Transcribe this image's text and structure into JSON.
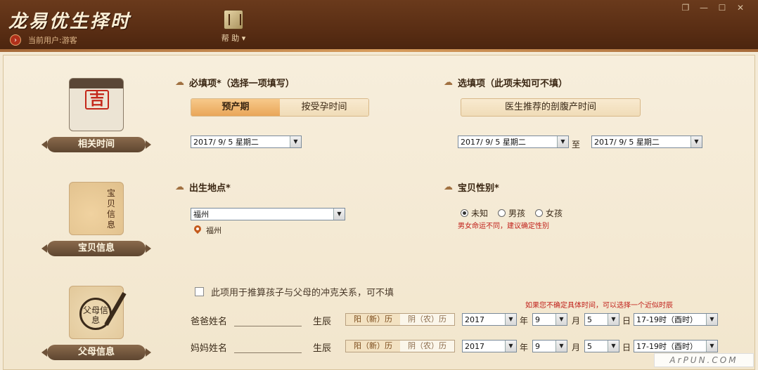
{
  "app": {
    "title": "龙易优生择时",
    "user_label": "当前用户:游客"
  },
  "menu": {
    "help": "帮 助 ▾"
  },
  "window_controls": [
    "❐",
    "—",
    "☐",
    "✕"
  ],
  "sidebar": [
    {
      "label": "相关时间",
      "image_text": "吉"
    },
    {
      "label": "宝贝信息",
      "image_text": "宝贝信息"
    },
    {
      "label": "父母信息",
      "image_text": "父母信息"
    }
  ],
  "required": {
    "title": "必填项*（选择一项填写）",
    "tabs": [
      {
        "label": "预产期",
        "active": true
      },
      {
        "label": "按受孕时间",
        "active": false
      }
    ],
    "date": "2017/ 9/ 5 星期二"
  },
  "optional": {
    "title": "选填项（此项未知可不填）",
    "tab": "医生推荐的剖腹产时间",
    "date_from": "2017/ 9/ 5 星期二",
    "to_label": "至",
    "date_to": "2017/ 9/ 5 星期二"
  },
  "birthplace": {
    "title": "出生地点*",
    "value": "福州",
    "location": "福州"
  },
  "gender": {
    "title": "宝贝性别*",
    "options": [
      {
        "label": "未知",
        "selected": true
      },
      {
        "label": "男孩",
        "selected": false
      },
      {
        "label": "女孩",
        "selected": false
      }
    ],
    "warning": "男女命运不同，建议确定性别"
  },
  "parents": {
    "checkbox_label": "此项用于推算孩子与父母的冲克关系，可不填",
    "hint": "如果您不确定具体时间，可以选择一个近似时辰",
    "birth_label": "生辰",
    "solar": "阳（新）历",
    "lunar": "阴（农）历",
    "rows": [
      {
        "name_label": "爸爸姓名",
        "year": "2017",
        "month": "9",
        "day": "5",
        "hour": "17-19时（酉时）"
      },
      {
        "name_label": "妈妈姓名",
        "year": "2017",
        "month": "9",
        "day": "5",
        "hour": "17-19时（酉时）"
      }
    ],
    "units": {
      "year": "年",
      "month": "月",
      "day": "日"
    }
  },
  "watermark": "ArPUN.COM"
}
